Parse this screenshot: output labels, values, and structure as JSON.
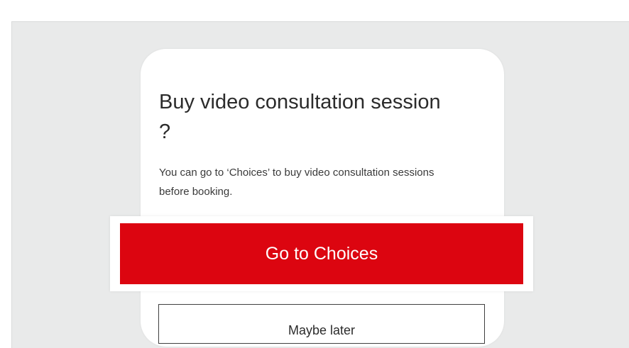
{
  "dialog": {
    "title": "Buy video consultation session ?",
    "body": "You can go to ‘Choices’ to buy video consultation sessions before booking.",
    "primary_label": "Go to Choices",
    "secondary_label": "Maybe later"
  },
  "colors": {
    "backdrop": "#e9eaea",
    "primary_button": "#dc0510",
    "primary_text": "#ffffff"
  }
}
